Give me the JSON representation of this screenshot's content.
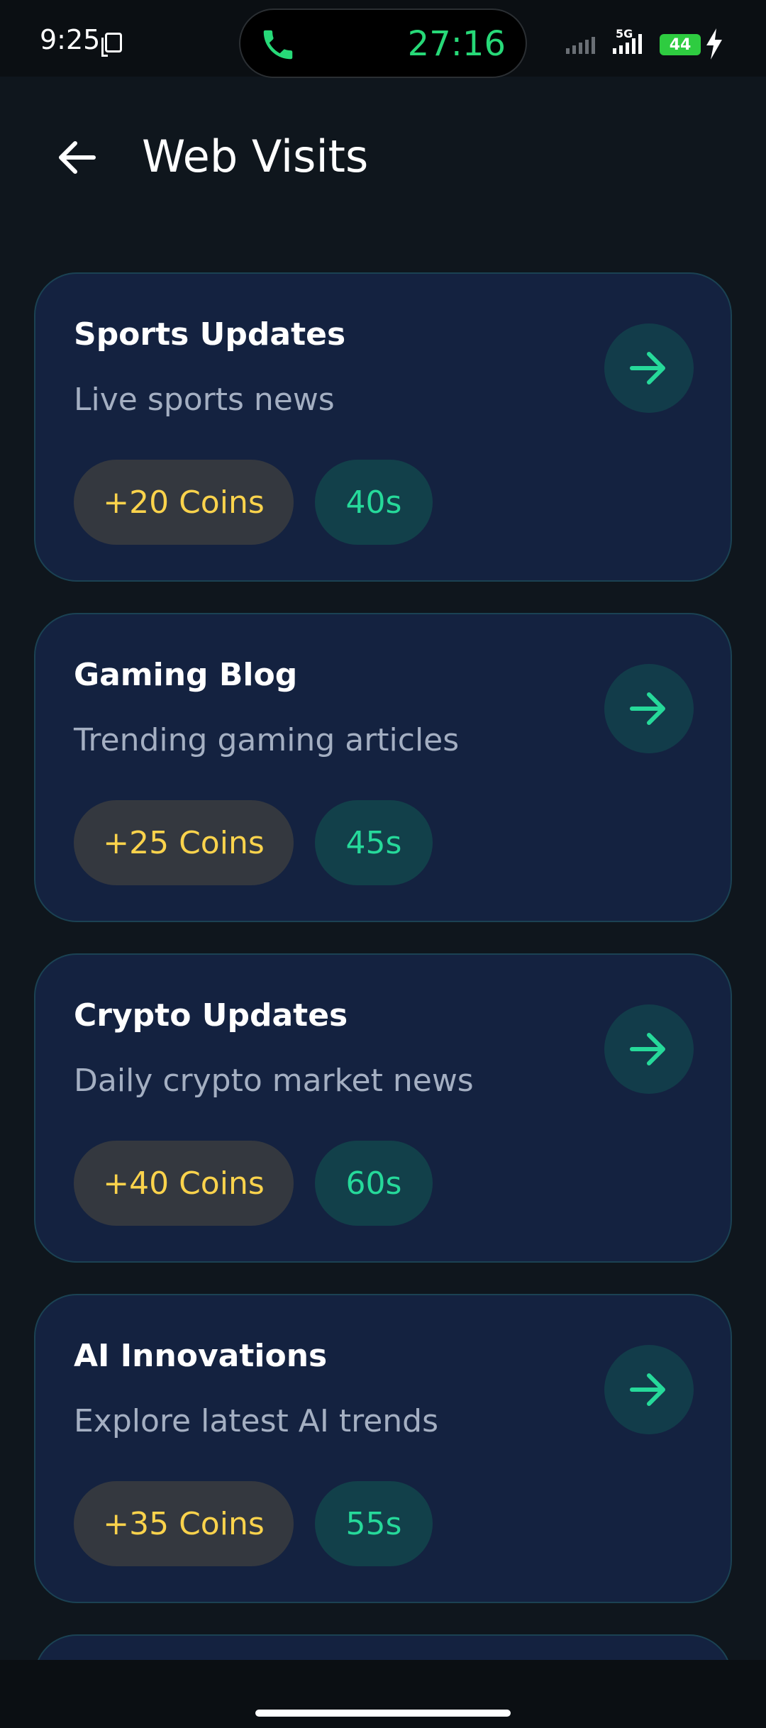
{
  "status_bar": {
    "time": "9:25",
    "call_timer": "27:16",
    "network": "5G",
    "battery": "44",
    "icons": [
      "screenshot-icon",
      "phone-icon",
      "signal-icon",
      "charging-icon"
    ]
  },
  "app_bar": {
    "title": "Web Visits",
    "back_icon": "arrow-left-icon"
  },
  "visits": [
    {
      "title": "Sports Updates",
      "subtitle": "Live sports news",
      "reward": "+20 Coins",
      "duration": "40s"
    },
    {
      "title": "Gaming Blog",
      "subtitle": "Trending gaming articles",
      "reward": "+25 Coins",
      "duration": "45s"
    },
    {
      "title": "Crypto Updates",
      "subtitle": "Daily crypto market news",
      "reward": "+40 Coins",
      "duration": "60s"
    },
    {
      "title": "AI Innovations",
      "subtitle": "Explore latest AI trends",
      "reward": "+35 Coins",
      "duration": "55s"
    }
  ],
  "colors": {
    "background": "#0f161d",
    "card": "#142240",
    "card_border": "#1b4253",
    "accent_green": "#26d99a",
    "coin_yellow": "#fbd34c"
  }
}
